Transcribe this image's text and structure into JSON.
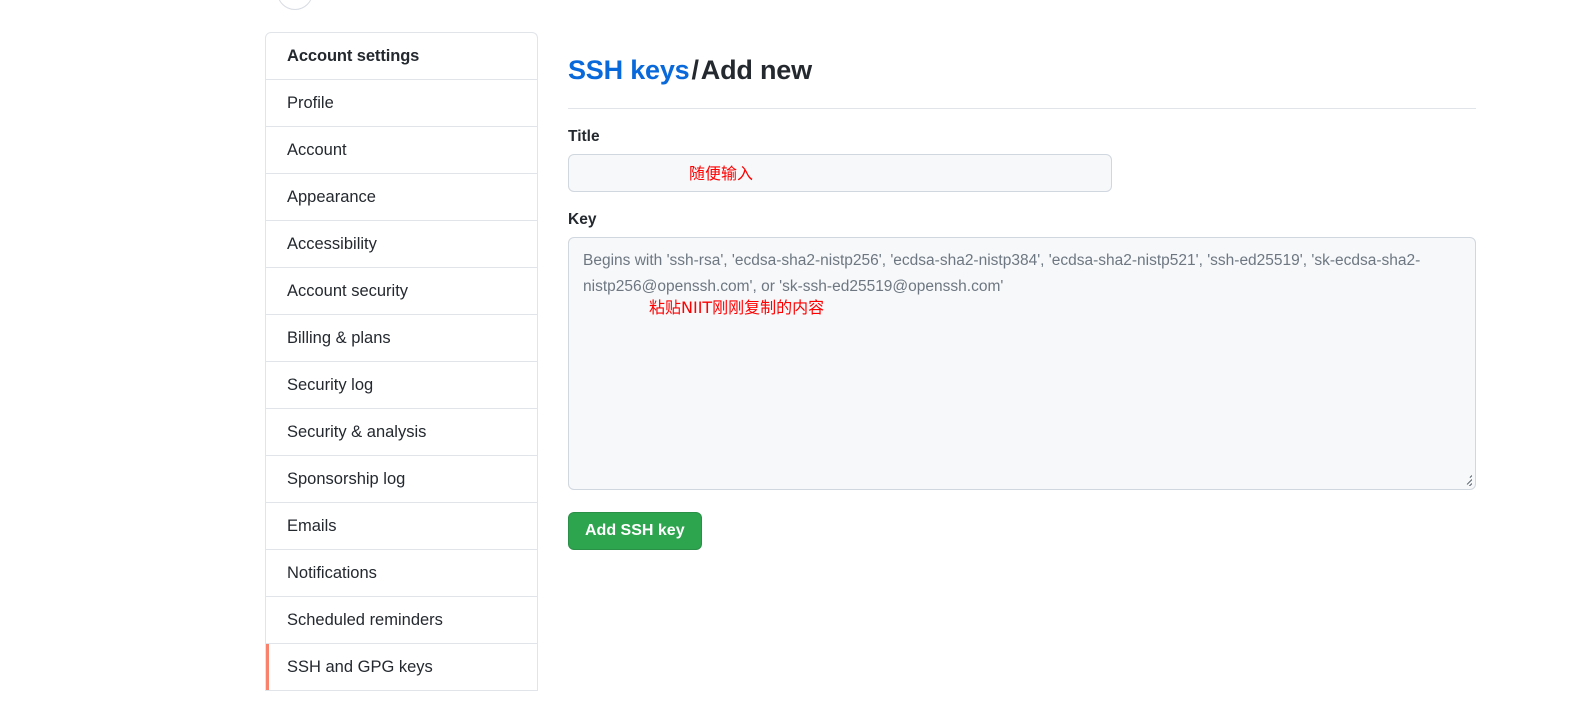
{
  "sidebar": {
    "header": "Account settings",
    "items": [
      {
        "label": "Profile",
        "active": false
      },
      {
        "label": "Account",
        "active": false
      },
      {
        "label": "Appearance",
        "active": false
      },
      {
        "label": "Accessibility",
        "active": false
      },
      {
        "label": "Account security",
        "active": false
      },
      {
        "label": "Billing & plans",
        "active": false
      },
      {
        "label": "Security log",
        "active": false
      },
      {
        "label": "Security & analysis",
        "active": false
      },
      {
        "label": "Sponsorship log",
        "active": false
      },
      {
        "label": "Emails",
        "active": false
      },
      {
        "label": "Notifications",
        "active": false
      },
      {
        "label": "Scheduled reminders",
        "active": false
      },
      {
        "label": "SSH and GPG keys",
        "active": true
      }
    ]
  },
  "main": {
    "heading_link": "SSH keys",
    "heading_separator": "/",
    "heading_current": "Add new",
    "title_label": "Title",
    "title_value": "",
    "title_placeholder": "",
    "key_label": "Key",
    "key_value": "",
    "key_placeholder": "Begins with 'ssh-rsa', 'ecdsa-sha2-nistp256', 'ecdsa-sha2-nistp384', 'ecdsa-sha2-nistp521', 'ssh-ed25519', 'sk-ecdsa-sha2-nistp256@openssh.com', or 'sk-ssh-ed25519@openssh.com'",
    "submit_label": "Add SSH key"
  },
  "annotations": {
    "title_note": "随便输入",
    "key_note": "粘贴NIIT刚刚复制的内容",
    "color": "#ff0000"
  },
  "colors": {
    "link": "#0969da",
    "active_marker": "#f9826c",
    "button_green": "#2da44e",
    "field_background": "#f6f8fa",
    "border": "#d0d7de"
  }
}
